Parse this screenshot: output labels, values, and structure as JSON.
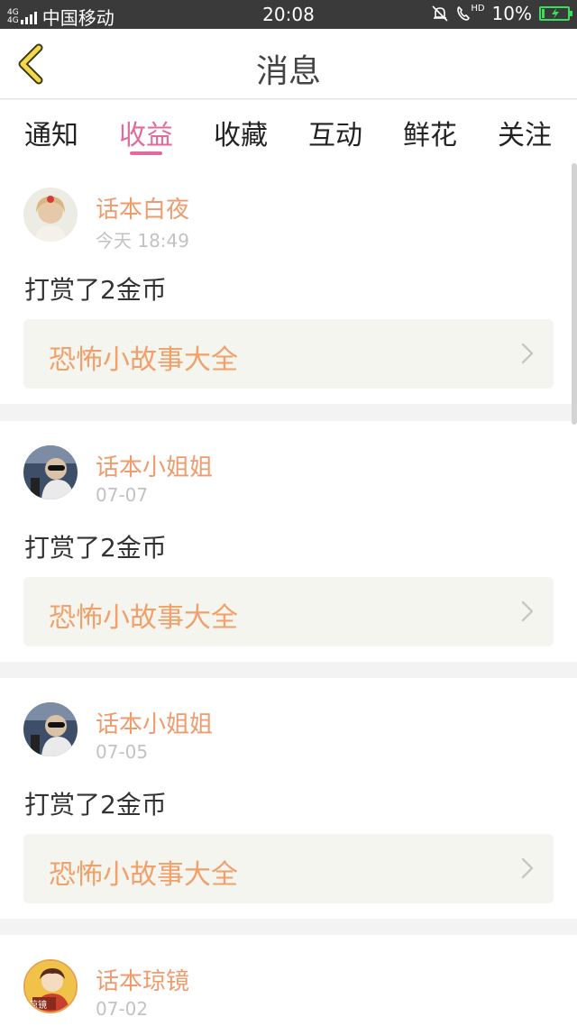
{
  "status_bar": {
    "network_top": "4G",
    "network_bottom": "4G",
    "carrier": "中国移动",
    "time": "20:08",
    "hd_label": "HD",
    "battery_text": "10%",
    "battery_level": 0.1,
    "battery_color": "#35e05a"
  },
  "header": {
    "title": "消息"
  },
  "tabs": [
    {
      "label": "通知",
      "active": false
    },
    {
      "label": "收益",
      "active": true
    },
    {
      "label": "收藏",
      "active": false
    },
    {
      "label": "互动",
      "active": false
    },
    {
      "label": "鲜花",
      "active": false
    },
    {
      "label": "关注",
      "active": false
    }
  ],
  "colors": {
    "accent_tab": "#e26a9e",
    "username": "#ef9b6d",
    "story_title": "#f0a06a"
  },
  "messages": [
    {
      "user": "话本白夜",
      "date": "今天 18:49",
      "text": "打赏了2金币",
      "story": "恐怖小故事大全",
      "avatar": "avatar-girl"
    },
    {
      "user": "话本小姐姐",
      "date": "07-07",
      "text": "打赏了2金币",
      "story": "恐怖小故事大全",
      "avatar": "avatar-sunglasses"
    },
    {
      "user": "话本小姐姐",
      "date": "07-05",
      "text": "打赏了2金币",
      "story": "恐怖小故事大全",
      "avatar": "avatar-sunglasses"
    },
    {
      "user": "话本琼镜",
      "date": "07-02",
      "text": "",
      "story": "",
      "avatar": "avatar-cartoon",
      "avatar_text": "琼镜"
    }
  ]
}
